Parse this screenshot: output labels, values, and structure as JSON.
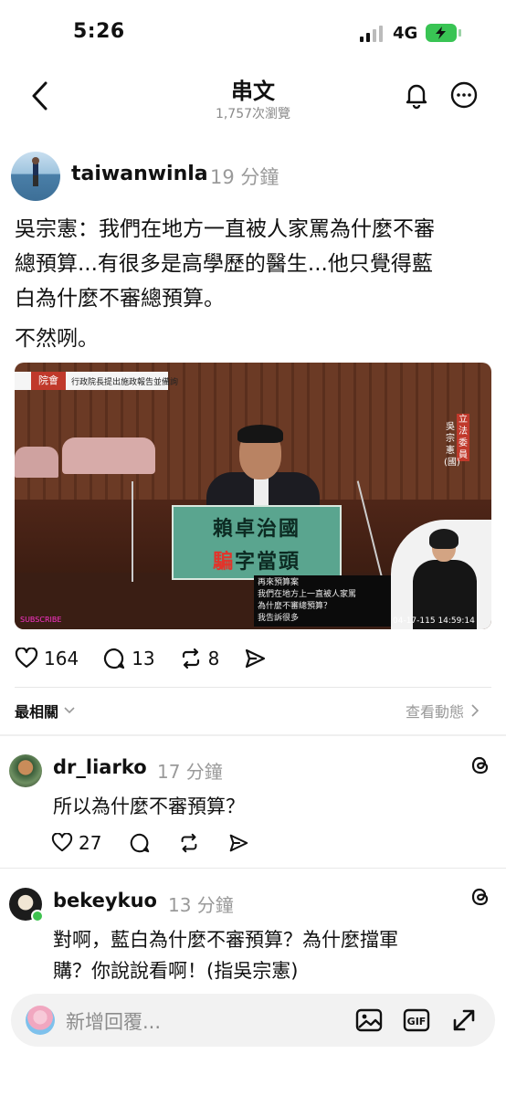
{
  "status_bar": {
    "time": "5:26",
    "network": "4G"
  },
  "header": {
    "title": "串文",
    "views": "1,757次瀏覽"
  },
  "post": {
    "username": "taiwanwinla",
    "time": "19 分鐘",
    "text_line1": "吳宗憲：我們在地方一直被人家罵為什麼不審",
    "text_line2": "總預算...有很多是高學歷的醫生...他只覺得藍",
    "text_line3": "白為什麼不審總預算。",
    "text_line4": "不然咧。",
    "media": {
      "top_tag": "院會",
      "top_text": "行政院長提出施政報告並備詢",
      "sign_line1": "賴卓治國",
      "sign_line2_red": "騙",
      "sign_line2_rest": "字當頭",
      "vertical_tag": "立法委員",
      "vertical_name": "吳宗憲(國)",
      "caption_line1": "再來預算案",
      "caption_line2": "我們在地方上一直被人家罵",
      "caption_line3": "為什麼不審總預算？",
      "caption_line4": "我告訴很多",
      "timestamp": "04-17-115 14:59:14",
      "logo": "SUBSCRIBE"
    },
    "likes": "164",
    "comments": "13",
    "reposts": "8"
  },
  "sort": {
    "label": "最相關",
    "activity": "查看動態"
  },
  "replies": [
    {
      "username": "dr_liarko",
      "time": "17 分鐘",
      "text": "所以為什麼不審預算？",
      "likes": "27"
    },
    {
      "username": "bekeykuo",
      "time": "13 分鐘",
      "text_line1": "對啊，藍白為什麼不審預算？為什麼擋軍",
      "text_line2": "購？你說說看啊！(指吳宗憲)"
    }
  ],
  "reply_bar": {
    "placeholder": "新增回覆..."
  },
  "colors": {
    "battery": "#39c454",
    "sign_green": "#5aa58f",
    "red": "#e2342b",
    "online": "#3ec24f"
  }
}
